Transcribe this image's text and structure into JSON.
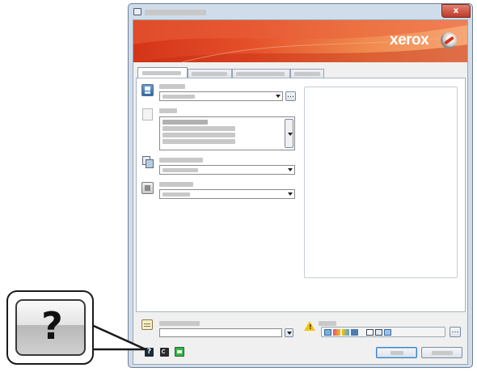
{
  "brand": {
    "name": "xerox"
  },
  "window": {
    "title": "",
    "close_label": "x"
  },
  "callout": {
    "symbol": "?"
  },
  "footer": {
    "help_label": "?"
  },
  "colors": {
    "titlebar": "#cfdcea",
    "close_button": "#c84a3a",
    "banner_red": "#d63a1e",
    "banner_orange": "#f07a3a",
    "panel_border": "#a8b4c2",
    "warning": "#f2c40c"
  }
}
